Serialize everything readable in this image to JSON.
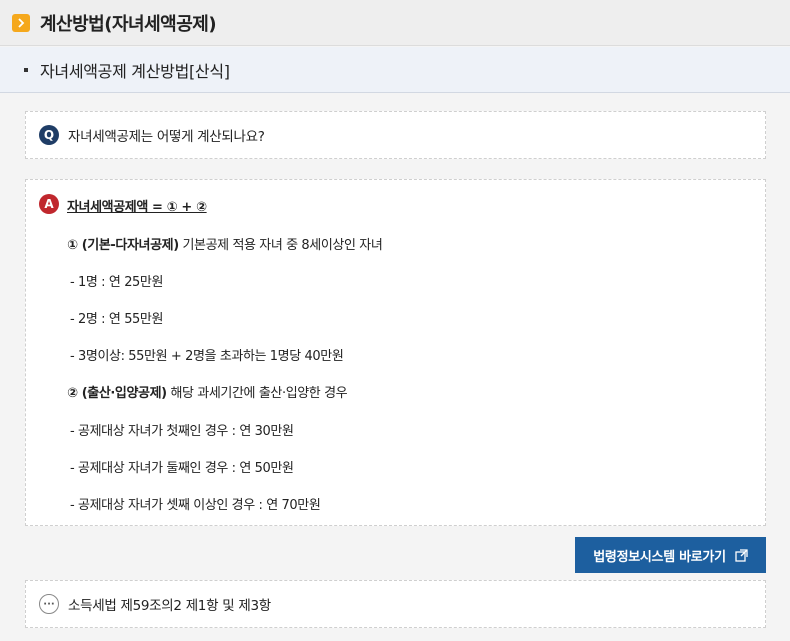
{
  "header": {
    "title": "계산방법(자녀세액공제)"
  },
  "subheader": {
    "title": "자녀세액공제 계산방법[산식]"
  },
  "question": {
    "badge": "Q",
    "text": "자녀세액공제는 어떻게 계산되나요?"
  },
  "answer": {
    "badge": "A",
    "heading": "자녀세액공제액 = ① + ②",
    "item1_title": "① (기본-다자녀공제)",
    "item1_desc": " 기본공제 적용 자녀 중 8세이상인 자녀",
    "item1_lines": [
      "- 1명 : 연 25만원",
      "- 2명 : 연 55만원",
      "- 3명이상: 55만원 + 2명을 초과하는 1명당 40만원"
    ],
    "item2_title": "② (출산·입양공제)",
    "item2_desc": " 해당 과세기간에 출산·입양한 경우",
    "item2_lines": [
      "- 공제대상 자녀가 첫째인 경우 : 연 30만원",
      "- 공제대상 자녀가 둘째인 경우 : 연 50만원",
      "- 공제대상 자녀가 셋째 이상인 경우 : 연 70만원"
    ]
  },
  "law_button": {
    "label": "법령정보시스템 바로가기"
  },
  "reference": {
    "badge": "···",
    "text": "소득세법 제59조의2 제1항 및 제3항"
  }
}
